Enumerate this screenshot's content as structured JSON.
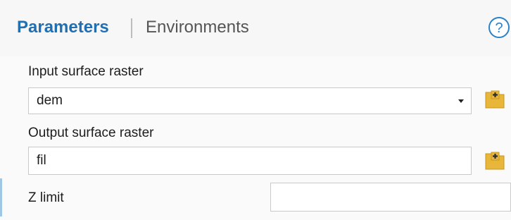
{
  "tabs": {
    "parameters": "Parameters",
    "environments": "Environments"
  },
  "icons": {
    "help": "help-icon",
    "add": "folder-add-icon",
    "dropdown": "chevron-down-icon"
  },
  "colors": {
    "active_tab": "#1f6fb2",
    "help_icon": "#2a82c9",
    "folder_icon": "#e8b73a"
  },
  "params": {
    "input_surface_raster": {
      "label": "Input surface raster",
      "value": "dem"
    },
    "output_surface_raster": {
      "label": "Output surface raster",
      "value": "fil"
    },
    "z_limit": {
      "label": "Z limit",
      "value": ""
    }
  }
}
